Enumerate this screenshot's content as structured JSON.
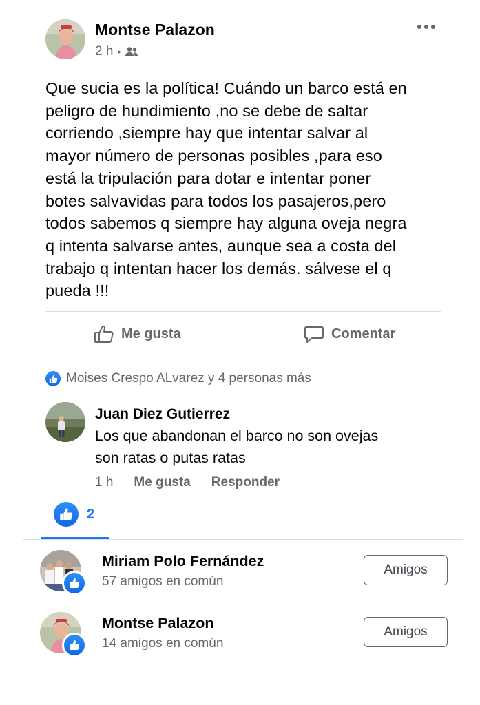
{
  "post": {
    "author": "Montse Palazon",
    "time": "2 h",
    "separator": "•",
    "audience_icon": "friends-icon",
    "menu_icon": "more-dots-icon",
    "lines": [
      "Que sucia es la política! Cuándo un barco está en",
      "peligro de hundimiento ,no se debe de saltar",
      "corriendo ,siempre hay que intentar salvar al",
      "mayor número de personas posibles ,para eso",
      "está la tripulación para dotar e intentar poner",
      "botes salvavidas para todos los pasajeros,pero",
      "todos sabemos q siempre hay alguna oveja negra",
      "q intenta salvarse antes, aunque sea a  costa del",
      "trabajo q intentan hacer los demás. sálvese el q",
      "pueda !!!"
    ]
  },
  "actions": {
    "like": "Me gusta",
    "comment": "Comentar"
  },
  "reactions": {
    "text": "Moises Crespo ALvarez y 4 personas más"
  },
  "comment": {
    "author": "Juan Diez Gutierrez",
    "lines": [
      "Los que abandonan el barco  no son ovejas",
      "son ratas o putas ratas"
    ],
    "time": "1 h",
    "like": "Me gusta",
    "reply": "Responder"
  },
  "likes_tab": {
    "count": "2"
  },
  "people": [
    {
      "name": "Miriam Polo Fernández",
      "mutual": "57 amigos en común",
      "button": "Amigos"
    },
    {
      "name": "Montse Palazon",
      "mutual": "14 amigos en común",
      "button": "Amigos"
    }
  ],
  "colors": {
    "accent": "#1877f2",
    "secondary_text": "#65676b",
    "divider": "#dadde1"
  }
}
